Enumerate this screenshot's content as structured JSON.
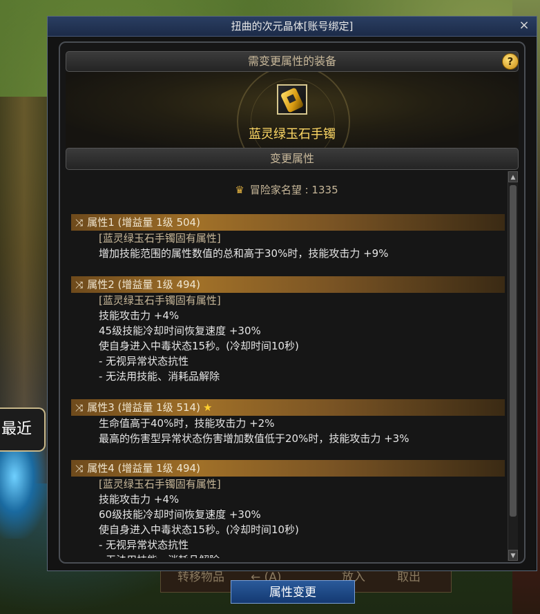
{
  "window": {
    "title": "扭曲的次元晶体[账号绑定]",
    "close_label": "×"
  },
  "equip_section": {
    "title": "需变更属性的装备",
    "help_label": "?",
    "item_name": "蓝灵绿玉石手镯"
  },
  "change_section": {
    "title": "变更属性",
    "fame_label": "冒险家名望 : 1335"
  },
  "properties": [
    {
      "header": "属性1 (增益量 1级 504)",
      "star": false,
      "lines": [
        "[蓝灵绿玉石手镯固有属性]",
        "增加技能范围的属性数值的总和高于30%时，技能攻击力 +9%"
      ]
    },
    {
      "header": "属性2 (增益量 1级 494)",
      "star": false,
      "lines": [
        "[蓝灵绿玉石手镯固有属性]",
        "技能攻击力 +4%",
        "45级技能冷却时间恢复速度 +30%",
        "使自身进入中毒状态15秒。(冷却时间10秒)",
        "- 无视异常状态抗性",
        "- 无法用技能、消耗品解除"
      ]
    },
    {
      "header": "属性3 (增益量 1级 514)",
      "star": true,
      "lines": [
        "生命值高于40%时，技能攻击力 +2%",
        "最高的伤害型异常状态伤害增加数值低于20%时，技能攻击力 +3%"
      ]
    },
    {
      "header": "属性4 (增益量 1级 494)",
      "star": false,
      "lines": [
        "[蓝灵绿玉石手镯固有属性]",
        "技能攻击力 +4%",
        "60级技能冷却时间恢复速度 +30%",
        "使自身进入中毒状态15秒。(冷却时间10秒)",
        "- 无视异常状态抗性",
        "- 无法用技能、消耗品解除"
      ]
    }
  ],
  "apply_button": "属性变更",
  "side_button": "最近",
  "bottom_bar": {
    "move_item": "转移物品",
    "arrow_hint": "← (A)",
    "put_in": "放入",
    "take_out": "取出"
  },
  "colors": {
    "accent_gold": "#ffd966",
    "title_bar": "#1c2b48",
    "button_blue": "#143a72"
  },
  "icons": {
    "shuffle": "shuffle-icon",
    "fame": "crown-icon",
    "star": "star-icon",
    "help": "question-icon"
  }
}
